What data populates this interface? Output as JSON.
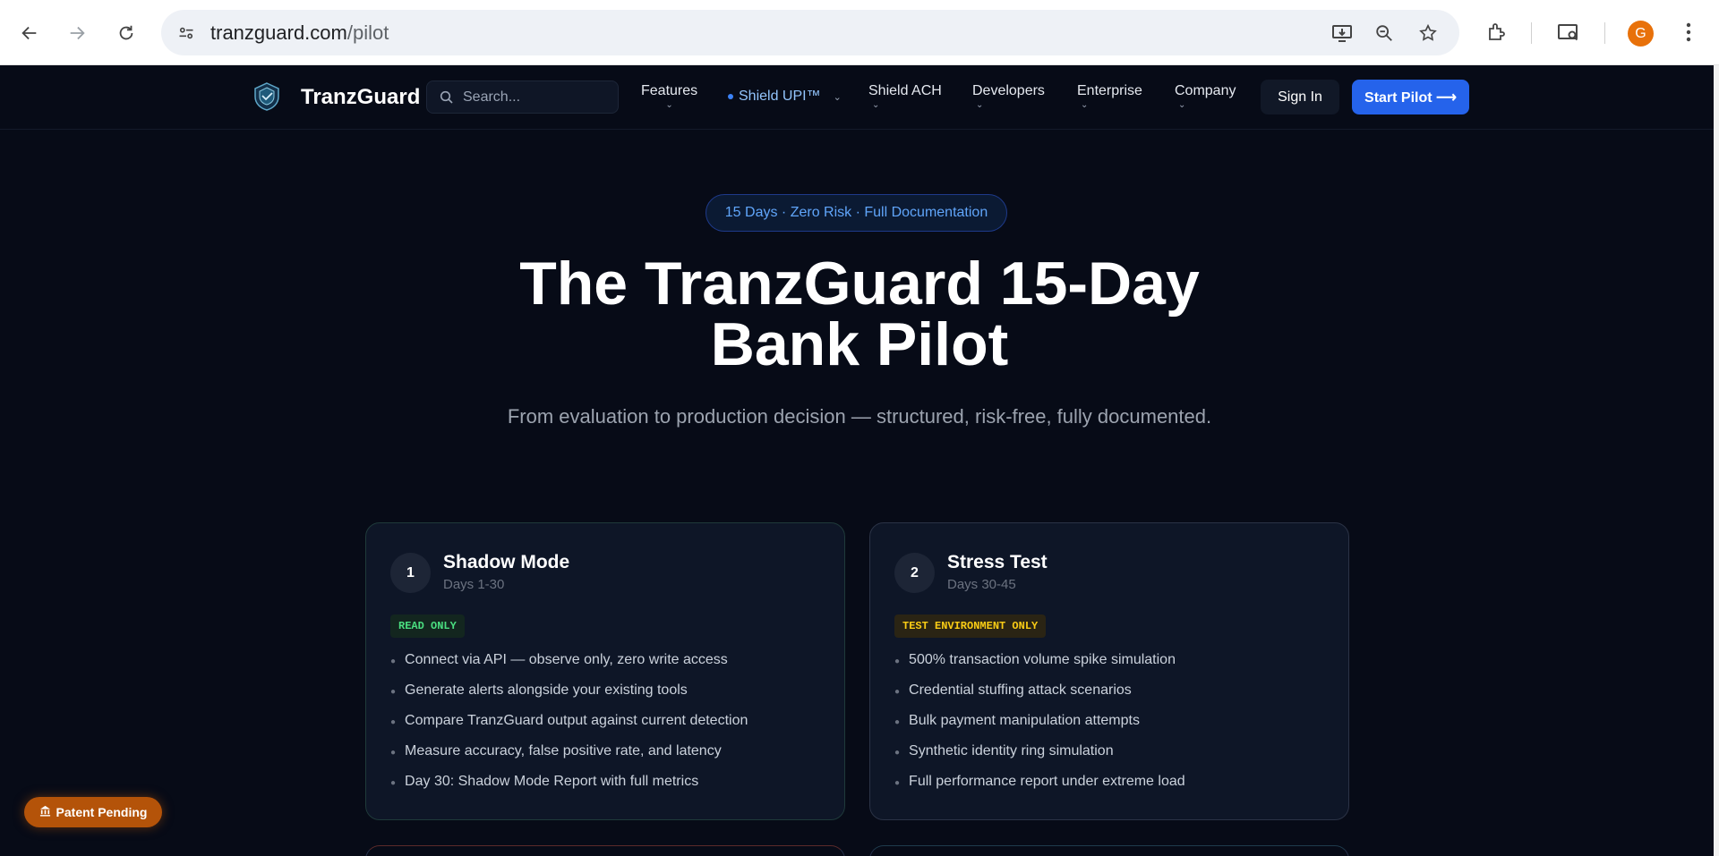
{
  "browser": {
    "url_domain": "tranzguard.com",
    "url_path": "/pilot",
    "profile_initial": "G"
  },
  "nav": {
    "brand": "TranzGuard",
    "search_placeholder": "Search...",
    "items": [
      {
        "label": "Features",
        "chevron": "⌄"
      },
      {
        "label": "Shield UPI™",
        "chevron": "⌄"
      },
      {
        "label": "Shield ACH",
        "chevron": "⌄"
      },
      {
        "label": "Developers",
        "chevron": "⌄"
      },
      {
        "label": "Enterprise",
        "chevron": "⌄"
      },
      {
        "label": "Company",
        "chevron": "⌄"
      }
    ],
    "sign_in": "Sign In",
    "start_pilot": "Start Pilot ⟶"
  },
  "hero": {
    "badge": "15 Days · Zero Risk · Full Documentation",
    "title_line1": "The TranzGuard 15-Day",
    "title_line2": "Bank Pilot",
    "subtitle": "From evaluation to production decision — structured, risk-free, fully documented."
  },
  "cards": [
    {
      "number": "1",
      "title": "Shadow Mode",
      "days": "Days 1-30",
      "tag": "READ ONLY",
      "items": [
        "Connect via API — observe only, zero write access",
        "Generate alerts alongside your existing tools",
        "Compare TranzGuard output against current detection",
        "Measure accuracy, false positive rate, and latency",
        "Day 30: Shadow Mode Report with full metrics"
      ]
    },
    {
      "number": "2",
      "title": "Stress Test",
      "days": "Days 30-45",
      "tag": "TEST ENVIRONMENT ONLY",
      "items": [
        "500% transaction volume spike simulation",
        "Credential stuffing attack scenarios",
        "Bulk payment manipulation attempts",
        "Synthetic identity ring simulation",
        "Full performance report under extreme load"
      ]
    }
  ],
  "patent_badge": "Patent Pending",
  "colors": {
    "background": "#070b17",
    "accent": "#2563eb",
    "badge_text": "#60a5fa",
    "tag_green": "#4ade80",
    "tag_yellow": "#facc15",
    "patent": "#b45309"
  }
}
